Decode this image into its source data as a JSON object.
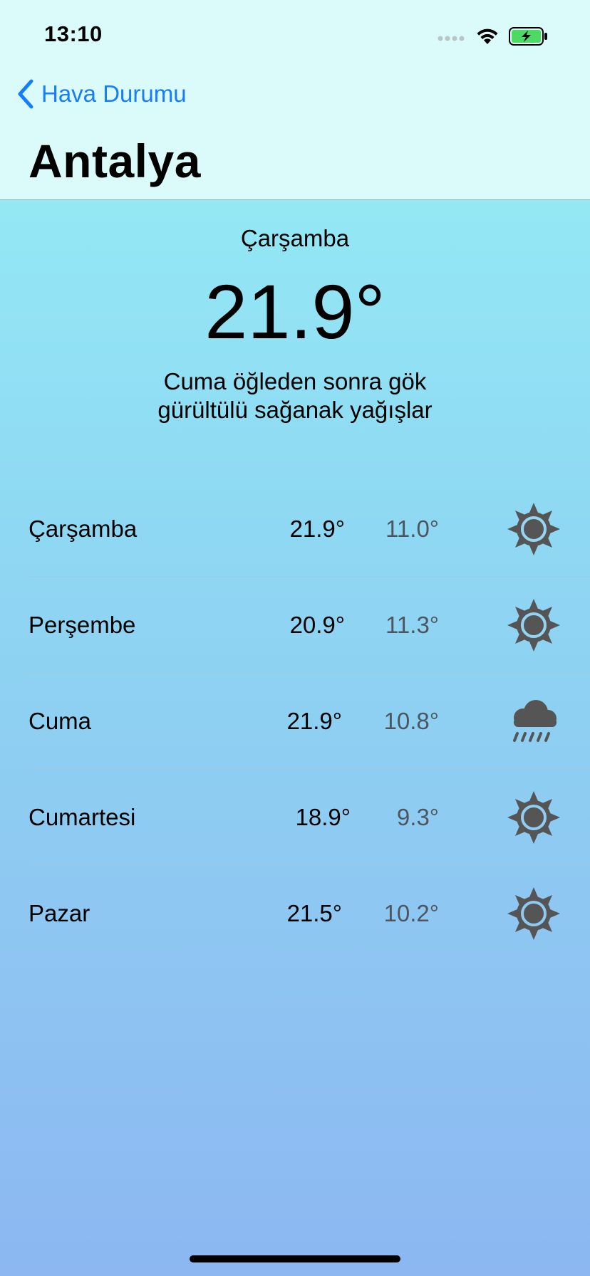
{
  "status_bar": {
    "time": "13:10"
  },
  "nav": {
    "back_label": "Hava Durumu",
    "title": "Antalya"
  },
  "current": {
    "day": "Çarşamba",
    "temperature": "21.9°",
    "summary": "Cuma öğleden sonra gök gürültülü sağanak yağışlar"
  },
  "forecast": [
    {
      "day": "Çarşamba",
      "high": "21.9°",
      "low": "11.0°",
      "icon": "sun-icon"
    },
    {
      "day": "Perşembe",
      "high": "20.9°",
      "low": "11.3°",
      "icon": "sun-icon"
    },
    {
      "day": "Cuma",
      "high": "21.9°",
      "low": "10.8°",
      "icon": "rain-cloud-icon"
    },
    {
      "day": "Cumartesi",
      "high": "18.9°",
      "low": "9.3°",
      "icon": "sun-icon"
    },
    {
      "day": "Pazar",
      "high": "21.5°",
      "low": "10.2°",
      "icon": "sun-icon"
    }
  ],
  "colors": {
    "accent": "#147efb",
    "icon": "#555555",
    "low_temp": "#4d5660",
    "battery": "#4cd964"
  }
}
